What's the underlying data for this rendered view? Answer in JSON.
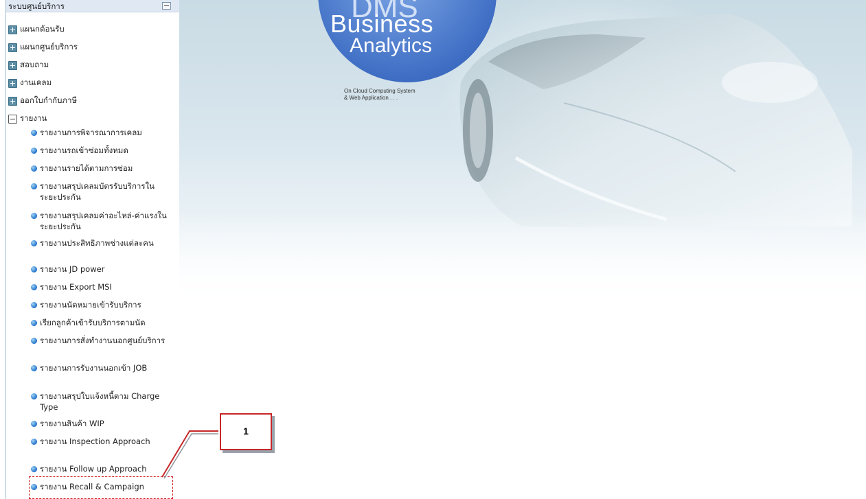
{
  "sidebar": {
    "header": "ระบบศูนย์บริการ",
    "groups": [
      {
        "label": "แผนกต้อนรับ"
      },
      {
        "label": "แผนกศูนย์บริการ"
      },
      {
        "label": "สอบถาม"
      },
      {
        "label": "งานเคลม"
      },
      {
        "label": "ออกใบกำกับภาษี"
      },
      {
        "label": "รายงาน"
      }
    ],
    "reports": [
      {
        "label": "รายงานการพิจารณาการเคลม"
      },
      {
        "label": "รายงานรถเข้าซ่อมทั้งหมด"
      },
      {
        "label": "รายงานรายได้ตามการซ่อม"
      },
      {
        "label": "รายงานสรุปเคลมบัตรรับบริการในระยะประกัน"
      },
      {
        "label": "รายงานสรุปเคลมค่าอะไหล่-ค่าแรงในระยะประกัน"
      },
      {
        "label": "รายงานประสิทธิภาพช่างแต่ละคน"
      },
      {
        "label": "รายงาน JD power"
      },
      {
        "label": "รายงาน Export MSI"
      },
      {
        "label": "รายงานนัดหมายเข้ารับบริการ"
      },
      {
        "label": "เรียกลูกค้าเข้ารับบริการตามนัด"
      },
      {
        "label": "รายงานการสั่งทำงานนอกศูนย์บริการ"
      },
      {
        "label": "รายงานการรับงานนอกเข้า JOB"
      },
      {
        "label": "รายงานสรุปใบแจ้งหนี้ตาม Charge Type"
      },
      {
        "label": "รายงานสินค้า WIP"
      },
      {
        "label": "รายงาน Inspection Approach"
      },
      {
        "label": "รายงาน Follow up Approach"
      },
      {
        "label": "รายงาน Recall & Campaign"
      }
    ]
  },
  "banner": {
    "logo_top": "DMS",
    "logo_line1": "Business",
    "logo_line2": "Analytics",
    "tagline_line1": "On Cloud Computing System",
    "tagline_line2": "& Web Application . . ."
  },
  "callout": {
    "number": "1"
  },
  "colors": {
    "callout_red": "#c62828",
    "bullet_blue": "#1e6ec9",
    "plus_box": "#5d8fa6"
  },
  "icons": {
    "collapse": "minus-box-icon",
    "expand": "plus-box-icon",
    "report": "bullet-dot-icon"
  }
}
